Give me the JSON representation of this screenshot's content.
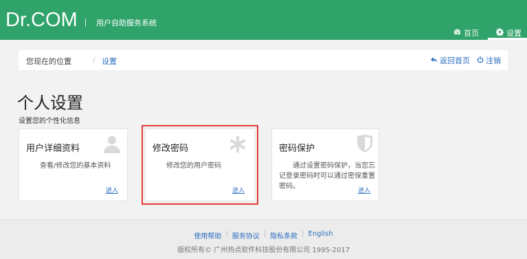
{
  "header": {
    "brand": "Dr.COM",
    "subtitle": "用户自助服务系统",
    "nav": {
      "home_label": "首页",
      "settings_label": "设置"
    },
    "accent_color": "#2fa36a"
  },
  "breadcrumb": {
    "prefix": "您现在的位置",
    "separator": "/",
    "current": "设置",
    "back_label": "返回首页",
    "logout_label": "注销"
  },
  "page": {
    "title": "个人设置",
    "description": "设置您的个性化信息"
  },
  "cards": [
    {
      "title": "用户详细资料",
      "description": "查看/修改您的基本资料",
      "link": "进入",
      "icon": "user-icon"
    },
    {
      "title": "修改密码",
      "description": "修改您的用户密码",
      "link": "进入",
      "icon": "asterisk-icon"
    },
    {
      "title": "密码保护",
      "description": "通过设置密码保护，当您忘记登录密码时可以通过密保重置密码。",
      "link": "进入",
      "icon": "shield-icon"
    }
  ],
  "footer": {
    "links": [
      "使用帮助",
      "服务协议",
      "隐私条款",
      "English"
    ],
    "separator": "|",
    "copyright": "版权所有© 广州热点软件科技股份有限公司 1995-2017"
  }
}
